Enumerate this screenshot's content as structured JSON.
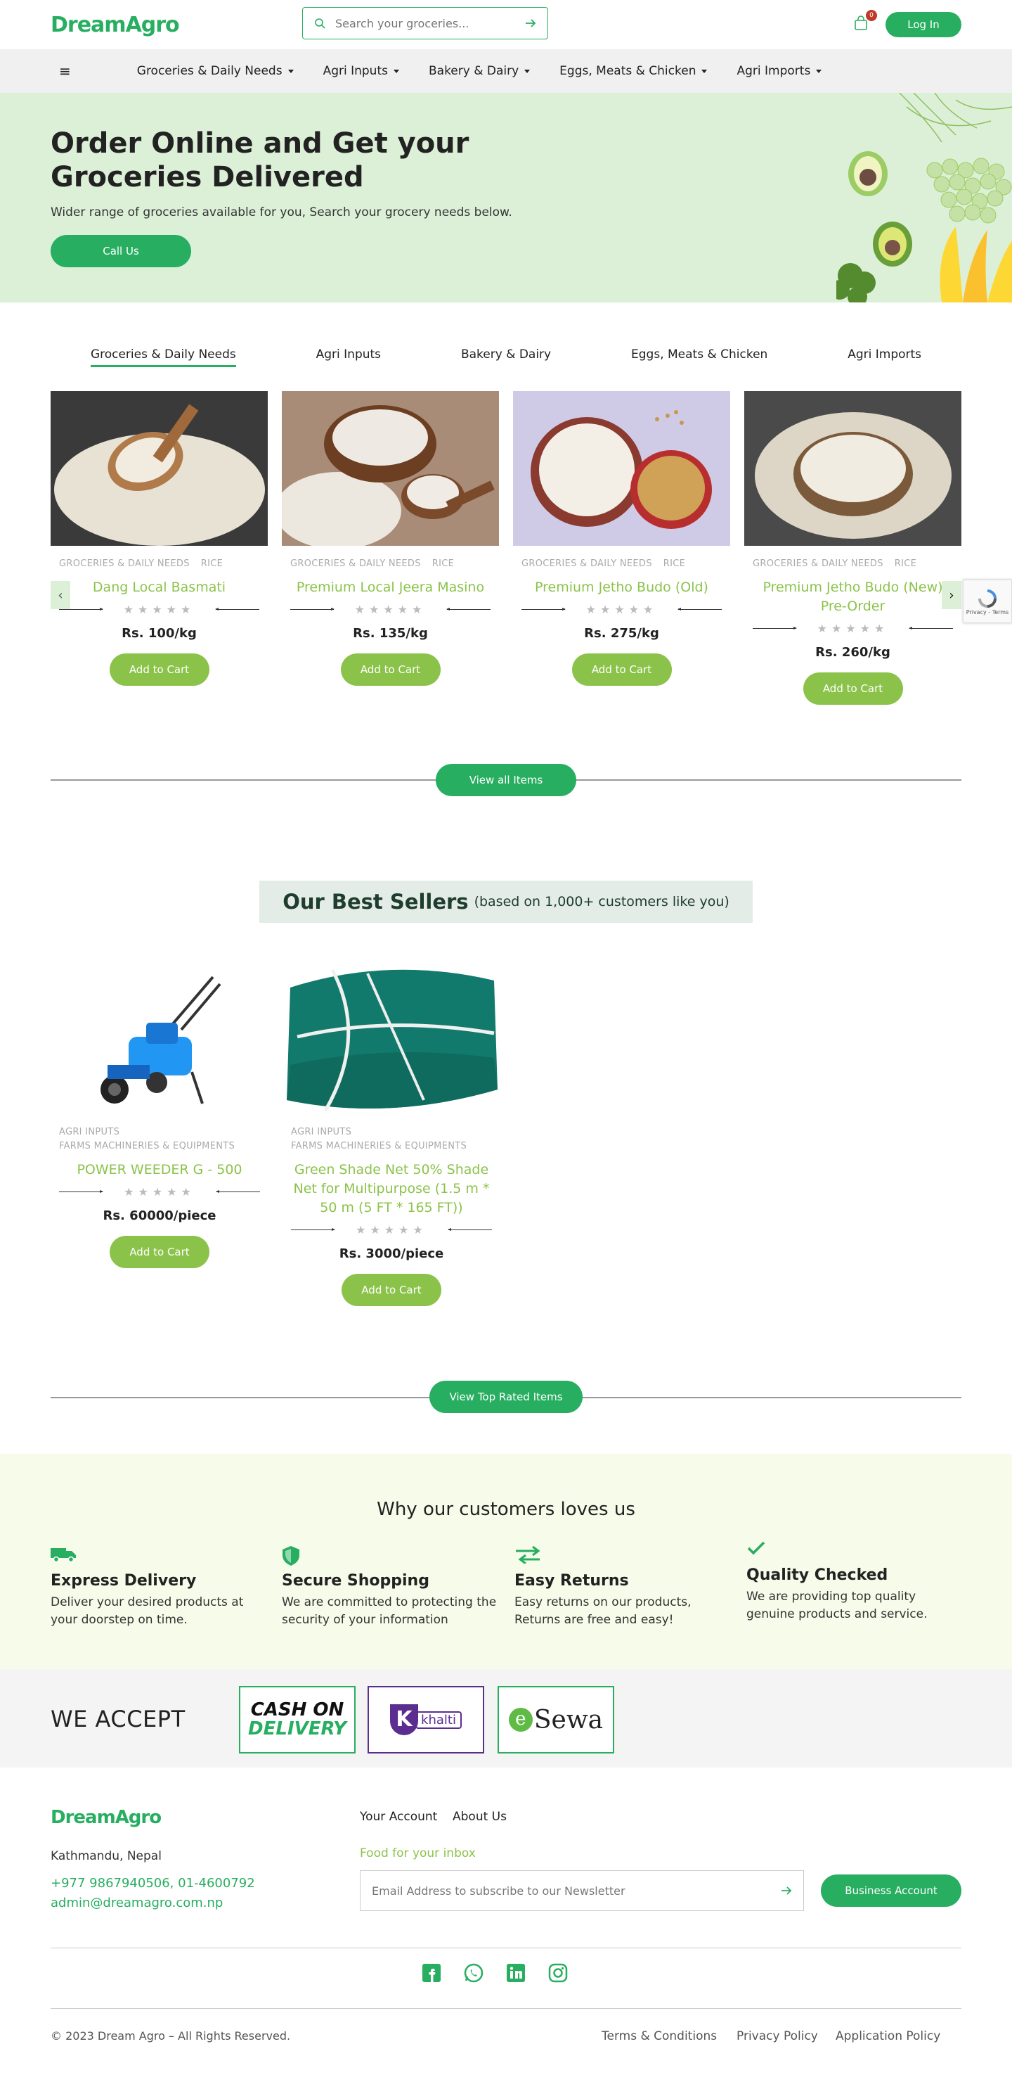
{
  "header": {
    "logo_text_1": "Dream",
    "logo_text_2": "Agro",
    "search_placeholder": "Search your groceries...",
    "cart_count": "0",
    "login_label": "Log In"
  },
  "nav": {
    "items": [
      {
        "label": "Groceries & Daily Needs"
      },
      {
        "label": "Agri Inputs"
      },
      {
        "label": "Bakery & Dairy"
      },
      {
        "label": "Eggs, Meats & Chicken"
      },
      {
        "label": "Agri Imports"
      }
    ]
  },
  "hero": {
    "title": "Order Online and Get your Groceries Delivered",
    "subtitle": "Wider range of groceries available for you, Search your grocery needs below.",
    "cta_label": "Call Us"
  },
  "category_tabs": [
    {
      "label": "Groceries & Daily Needs",
      "active": true
    },
    {
      "label": "Agri Inputs"
    },
    {
      "label": "Bakery & Dairy"
    },
    {
      "label": "Eggs, Meats & Chicken"
    },
    {
      "label": "Agri Imports"
    }
  ],
  "products": [
    {
      "cat1": "GROCERIES & DAILY NEEDS",
      "cat2": "RICE",
      "name": "Dang Local Basmati",
      "price": "Rs. 100/kg",
      "button": "Add to Cart"
    },
    {
      "cat1": "GROCERIES & DAILY NEEDS",
      "cat2": "RICE",
      "name": "Premium Local Jeera Masino",
      "price": "Rs. 135/kg",
      "button": "Add to Cart"
    },
    {
      "cat1": "GROCERIES & DAILY NEEDS",
      "cat2": "RICE",
      "name": "Premium Jetho Budo (Old)",
      "price": "Rs. 275/kg",
      "button": "Add to Cart"
    },
    {
      "cat1": "GROCERIES & DAILY NEEDS",
      "cat2": "RICE",
      "name": "Premium Jetho Budo (New) Pre-Order",
      "price": "Rs. 260/kg",
      "button": "Add to Cart"
    }
  ],
  "view_all_label": "View all Items",
  "recaptcha_text": "Privacy - Terms",
  "best_sellers": {
    "title": "Our Best Sellers",
    "subtitle": "(based on 1,000+ customers like you)",
    "items": [
      {
        "cat1": "AGRI INPUTS",
        "cat2": "FARMS MACHINERIES & EQUIPMENTS",
        "name": "POWER WEEDER G - 500",
        "price": "Rs. 60000/piece",
        "button": "Add to Cart"
      },
      {
        "cat1": "AGRI INPUTS",
        "cat2": "FARMS MACHINERIES & EQUIPMENTS",
        "name": "Green Shade Net 50% Shade Net for Multipurpose (1.5 m * 50 m (5 FT * 165 FT))",
        "price": "Rs. 3000/piece",
        "button": "Add to Cart"
      }
    ],
    "view_top_label": "View Top Rated Items"
  },
  "why": {
    "title": "Why our customers loves us",
    "features": [
      {
        "title": "Express Delivery",
        "text": "Deliver your desired products at your doorstep on time.",
        "icon": "truck-icon"
      },
      {
        "title": "Secure Shopping",
        "text": "We are committed to protecting the security of your information",
        "icon": "shield-icon"
      },
      {
        "title": "Easy Returns",
        "text": "Easy returns on our products, Returns are free and easy!",
        "icon": "return-arrows-icon"
      },
      {
        "title": "Quality Checked",
        "text": "We are providing top quality genuine products and service.",
        "icon": "check-icon"
      }
    ]
  },
  "accept": {
    "title": "WE ACCEPT",
    "cod_1": "CASH ON",
    "cod_2": "DELIVERY",
    "khalti": "khalti",
    "esewa_e": "e",
    "esewa": "Sewa"
  },
  "footer": {
    "address": "Kathmandu, Nepal",
    "phone": "+977 9867940506, 01-4600792",
    "email": "admin@dreamagro.com.np",
    "link_account": "Your Account",
    "link_about": "About Us",
    "inbox_label": "Food for your inbox",
    "newsletter_placeholder": "Email Address to subscribe to our Newsletter",
    "business_label": "Business Account",
    "copyright": "© 2023 Dream Agro – All Rights Reserved.",
    "terms": "Terms & Conditions",
    "privacy": "Privacy Policy",
    "application": "Application Policy"
  },
  "colors": {
    "primary": "#27ae60",
    "secondary": "#8bc34a",
    "hero_bg": "#dcf0d8",
    "why_bg": "#f7fbe9",
    "accept_bg": "#f4f4f4"
  }
}
